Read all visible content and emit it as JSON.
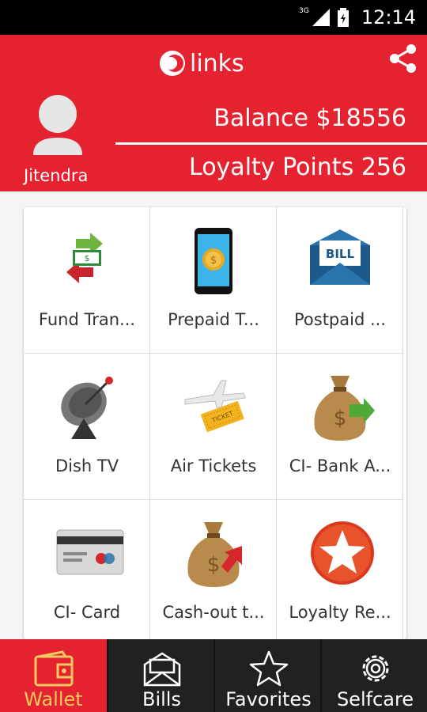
{
  "status_bar": {
    "network": "3G",
    "time": "12:14"
  },
  "header": {
    "app_name": "links",
    "user_name": "Jitendra",
    "balance": "Balance $18556",
    "loyalty_points": "Loyalty Points 256"
  },
  "services": [
    {
      "label": "Fund Tran...",
      "icon": "fund-transfer-icon"
    },
    {
      "label": "Prepaid T...",
      "icon": "mobile-prepaid-icon"
    },
    {
      "label": "Postpaid ...",
      "icon": "bill-envelope-icon"
    },
    {
      "label": "Dish TV",
      "icon": "satellite-dish-icon"
    },
    {
      "label": "Air Tickets",
      "icon": "airplane-ticket-icon"
    },
    {
      "label": "CI- Bank A...",
      "icon": "money-bag-icon"
    },
    {
      "label": "CI- Card",
      "icon": "credit-card-icon"
    },
    {
      "label": "Cash-out t...",
      "icon": "money-bag-arrow-icon"
    },
    {
      "label": "Loyalty Re...",
      "icon": "star-badge-icon"
    }
  ],
  "nav": {
    "tabs": [
      {
        "label": "Wallet",
        "icon": "wallet-icon",
        "active": true
      },
      {
        "label": "Bills",
        "icon": "bill-envelope-icon",
        "active": false
      },
      {
        "label": "Favorites",
        "icon": "star-icon",
        "active": false
      },
      {
        "label": "Selfcare",
        "icon": "gear-icon",
        "active": false
      }
    ]
  },
  "colors": {
    "brand_red": "#e5222f",
    "nav_dark": "#1f2220",
    "active_tab_text": "#f2c85f"
  }
}
